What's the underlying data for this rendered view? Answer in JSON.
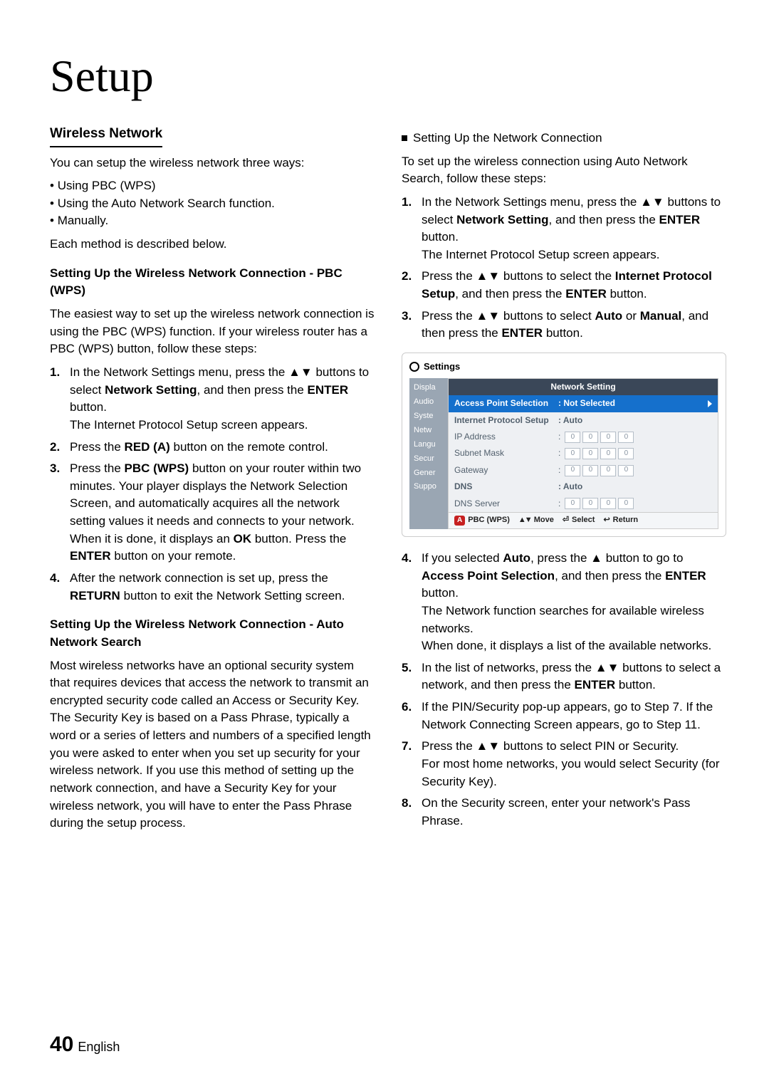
{
  "title": "Setup",
  "left": {
    "subheading": "Wireless Network",
    "intro": "You can setup the wireless network three ways:",
    "bullets": [
      "Using PBC (WPS)",
      "Using the Auto Network Search function.",
      "Manually."
    ],
    "after_bullets": "Each method is described below.",
    "pbc_heading": "Setting Up the Wireless Network Connection - PBC (WPS)",
    "pbc_intro": "The easiest way to set up the wireless network connection is using the PBC (WPS) function. If your wireless router has a PBC (WPS) button, follow these steps:",
    "pbc_steps": [
      {
        "n": "1.",
        "pre": "In the Network Settings menu, press the ▲▼ buttons to select ",
        "b1": "Network Setting",
        "mid": ", and then press the ",
        "b2": "ENTER",
        "post": " button.",
        "line2": "The Internet Protocol Setup screen appears."
      },
      {
        "n": "2.",
        "pre": "Press the ",
        "b1": "RED (A)",
        "post": " button on the remote control."
      },
      {
        "n": "3.",
        "pre": "Press the ",
        "b1": "PBC (WPS)",
        "mid": " button on your router within two minutes. Your player displays the Network Selection Screen, and automatically acquires all the network setting values it needs and connects to your network. When it is done, it displays an ",
        "b2": "OK",
        "mid2": " button. Press the ",
        "b3": "ENTER",
        "post": " button on your remote."
      },
      {
        "n": "4.",
        "pre": "After the network connection is set up, press the ",
        "b1": "RETURN",
        "post": " button to exit the Network Setting screen."
      }
    ],
    "auto_heading": "Setting Up the Wireless Network Connection - Auto Network Search",
    "auto_body": "Most wireless networks have an optional security system that requires devices that access the network to transmit an encrypted security code called an Access or Security Key. The Security Key is based on a Pass Phrase, typically a word or a series of letters and numbers of a specified length you were asked to enter when you set up security for your wireless network. If you use this method of setting up the network connection, and have a Security Key for your wireless network, you will have to enter the Pass Phrase during the setup process."
  },
  "right": {
    "square_heading": "Setting Up the Network Connection",
    "intro": "To set up the wireless connection using Auto Network Search, follow these steps:",
    "steps_a": [
      {
        "n": "1.",
        "pre": "In the Network Settings menu, press the ▲▼ buttons to select ",
        "b1": "Network Setting",
        "mid": ", and then press the ",
        "b2": "ENTER",
        "post": " button.",
        "line2": "The Internet Protocol Setup screen appears."
      },
      {
        "n": "2.",
        "pre": "Press the ▲▼ buttons to select the ",
        "b1": "Internet Protocol Setup",
        "mid": ", and then press the ",
        "b2": "ENTER",
        "post": " button."
      },
      {
        "n": "3.",
        "pre": "Press the ▲▼ buttons to select ",
        "b1": "Auto",
        "mid": " or ",
        "b2": "Manual",
        "mid2": ", and then press the ",
        "b3": "ENTER",
        "post": " button."
      }
    ],
    "settings": {
      "title": "Settings",
      "panel_title": "Network Setting",
      "side": [
        "Displa",
        "Audio",
        "Syste",
        "Netw",
        "Langu",
        "Secur",
        "Gener",
        "Suppo"
      ],
      "rows": {
        "aps_label": "Access Point Selection",
        "aps_val": ": Not Selected",
        "ips_label": "Internet Protocol Setup",
        "ips_val": ": Auto",
        "ip_label": "IP Address",
        "subnet_label": "Subnet Mask",
        "gateway_label": "Gateway",
        "dns_label": "DNS",
        "dns_val": ": Auto",
        "dnsserver_label": "DNS Server",
        "ip_cell": "0"
      },
      "footer": {
        "a": "A",
        "pbc": "PBC (WPS)",
        "move": "Move",
        "select": "Select",
        "ret": "Return"
      }
    },
    "steps_b": [
      {
        "n": "4.",
        "pre": "If you selected ",
        "b1": "Auto",
        "mid": ", press the ▲ button to go to ",
        "b2": "Access Point Selection",
        "mid2": ", and then press the ",
        "b3": "ENTER",
        "post": " button.",
        "line2": "The Network function searches for available wireless networks.",
        "line3": "When done, it displays a list of the available networks."
      },
      {
        "n": "5.",
        "pre": "In the list of networks, press the ▲▼ buttons to select a network, and then press the ",
        "b1": "ENTER",
        "post": " button."
      },
      {
        "n": "6.",
        "pre": "If the PIN/Security pop-up appears, go to Step 7. If the Network Connecting Screen appears, go to Step 11."
      },
      {
        "n": "7.",
        "pre": "Press the ▲▼ buttons to select PIN or Security.",
        "line2": "For most home networks, you would select Security (for Security Key)."
      },
      {
        "n": "8.",
        "pre": "On the Security screen, enter your network's Pass Phrase."
      }
    ]
  },
  "page": {
    "num": "40",
    "lang": "English"
  }
}
